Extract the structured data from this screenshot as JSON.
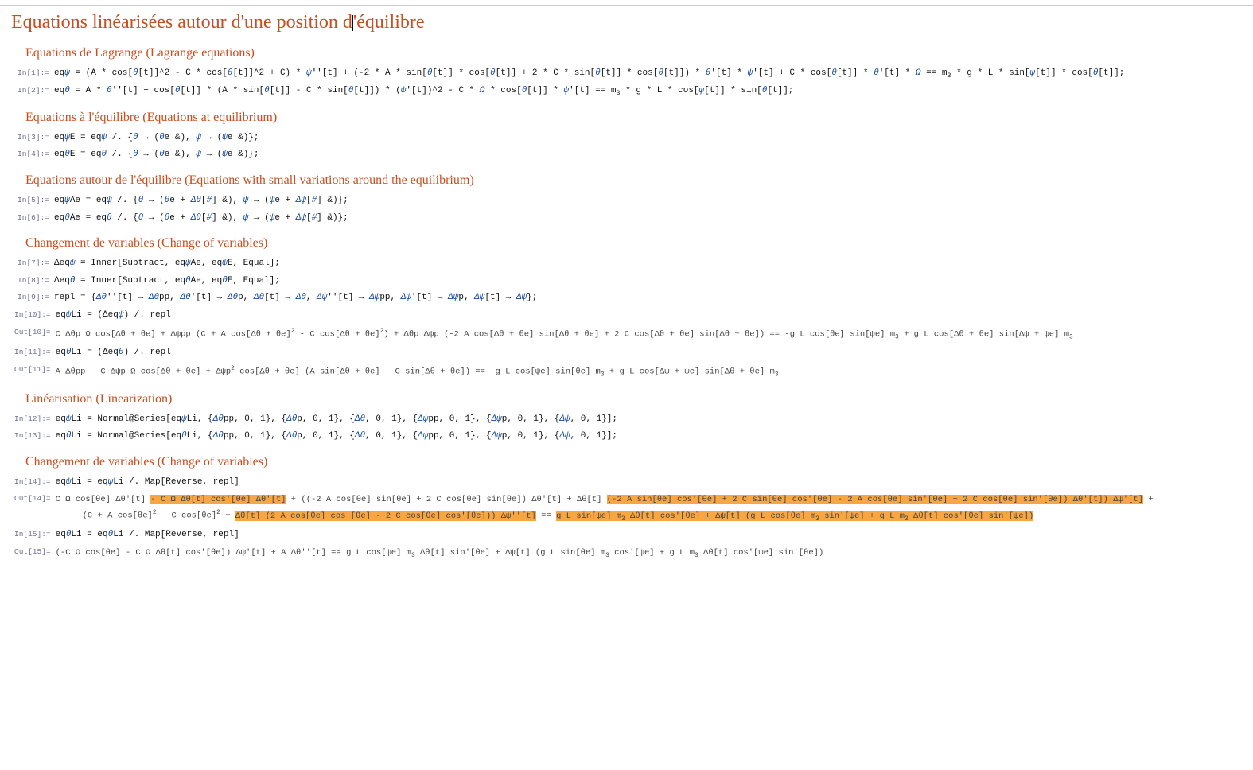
{
  "title_pre": "Equations linéarisées autour d'une position d",
  "title_post": "équilibre",
  "sections": {
    "s1": "Equations de Lagrange (Lagrange equations)",
    "s2": "Equations à l'équilibre (Equations at equilibrium)",
    "s3": "Equations autour de l'équilibre (Equations with small variations around the equilibrium)",
    "s4": "Changement de variables (Change of variables)",
    "s5": "Linéarisation (Linearization)",
    "s6": "Changement de variables (Change of variables)"
  },
  "labels": {
    "in1": "In[1]:=",
    "in2": "In[2]:=",
    "in3": "In[3]:=",
    "in4": "In[4]:=",
    "in5": "In[5]:=",
    "in6": "In[6]:=",
    "in7": "In[7]:=",
    "in8": "In[8]:=",
    "in9": "In[9]:=",
    "in10": "In[10]:=",
    "out10": "Out[10]=",
    "in11": "In[11]:=",
    "out11": "Out[11]=",
    "in12": "In[12]:=",
    "in13": "In[13]:=",
    "in14": "In[14]:=",
    "out14": "Out[14]=",
    "in15": "In[15]:=",
    "out15": "Out[15]="
  }
}
